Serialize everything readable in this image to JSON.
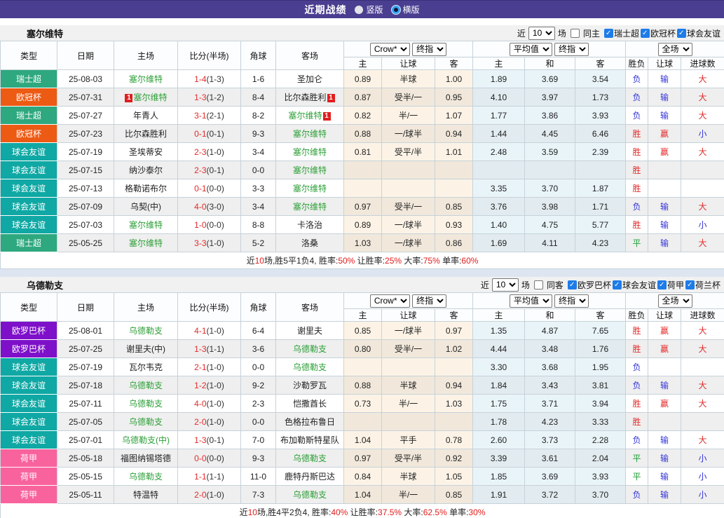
{
  "topbar": {
    "title": "近期战绩",
    "vertical": "竖版",
    "horizontal": "横版"
  },
  "colors": {
    "topbar_bg": "#4a3e91",
    "team_link_green": "#2fa039",
    "score_red": "#e32a2a",
    "checkbox_blue": "#1e7ce8",
    "section_gap": "#dde6f0"
  },
  "league_colors": {
    "瑞士超": "#2ea87e",
    "欧冠杯": "#ec5a14",
    "球会友谊": "#0fa8a4",
    "欧罗巴杯": "#7e10c9",
    "荷甲": "#f8639e"
  },
  "result_colors": {
    "胜": "#e32a2a",
    "赢": "#e32a2a",
    "大": "#e32a2a",
    "负": "#3434d8",
    "输": "#3434d8",
    "小": "#3434d8",
    "平": "#1ea038"
  },
  "table": {
    "cols": {
      "type": "类型",
      "date": "日期",
      "home": "主场",
      "score": "比分(半场)",
      "corner": "角球",
      "away": "客场",
      "h": "主",
      "handicap": "让球",
      "a": "客",
      "avg_h": "主",
      "avg_d": "和",
      "avg_a": "客",
      "result": "胜负",
      "result_handicap": "让球",
      "result_goals": "进球数"
    },
    "selects": {
      "source": "Crow*",
      "final": "终指",
      "average": "平均值",
      "final2": "终指",
      "scope": "全场"
    }
  },
  "sections": [
    {
      "team": "塞尔维特",
      "near": "近",
      "count": "10",
      "games": "场",
      "same": "同主",
      "leagues": [
        "瑞士超",
        "欧冠杯",
        "球会友谊"
      ],
      "rows": [
        {
          "league": "瑞士超",
          "date": "25-08-03",
          "home": {
            "name": "塞尔维特",
            "self": true
          },
          "score": "1-4",
          "half": "(1-3)",
          "corner": "1-6",
          "away": {
            "name": "圣加仑"
          },
          "odds": [
            "0.89",
            "半球",
            "1.00"
          ],
          "avg": [
            "1.89",
            "3.69",
            "3.54"
          ],
          "results": [
            "负",
            "输",
            "大"
          ]
        },
        {
          "league": "欧冠杯",
          "date": "25-07-31",
          "home": {
            "name": "塞尔维特",
            "self": true,
            "card_pre": "1"
          },
          "score": "1-3",
          "half": "(1-2)",
          "corner": "8-4",
          "away": {
            "name": "比尔森胜利",
            "card_post": "1"
          },
          "odds": [
            "0.87",
            "受半/一",
            "0.95"
          ],
          "avg": [
            "4.10",
            "3.97",
            "1.73"
          ],
          "results": [
            "负",
            "输",
            "大"
          ]
        },
        {
          "league": "瑞士超",
          "date": "25-07-27",
          "home": {
            "name": "年青人"
          },
          "score": "3-1",
          "half": "(2-1)",
          "corner": "8-2",
          "away": {
            "name": "塞尔维特",
            "self": true,
            "card_post": "1"
          },
          "odds": [
            "0.82",
            "半/一",
            "1.07"
          ],
          "avg": [
            "1.77",
            "3.86",
            "3.93"
          ],
          "results": [
            "负",
            "输",
            "大"
          ]
        },
        {
          "league": "欧冠杯",
          "date": "25-07-23",
          "home": {
            "name": "比尔森胜利"
          },
          "score": "0-1",
          "half": "(0-1)",
          "corner": "9-3",
          "away": {
            "name": "塞尔维特",
            "self": true
          },
          "odds": [
            "0.88",
            "一/球半",
            "0.94"
          ],
          "avg": [
            "1.44",
            "4.45",
            "6.46"
          ],
          "results": [
            "胜",
            "赢",
            "小"
          ]
        },
        {
          "league": "球会友谊",
          "date": "25-07-19",
          "home": {
            "name": "圣埃蒂安"
          },
          "score": "2-3",
          "half": "(1-0)",
          "corner": "3-4",
          "away": {
            "name": "塞尔维特",
            "self": true
          },
          "odds": [
            "0.81",
            "受平/半",
            "1.01"
          ],
          "avg": [
            "2.48",
            "3.59",
            "2.39"
          ],
          "results": [
            "胜",
            "赢",
            "大"
          ]
        },
        {
          "league": "球会友谊",
          "date": "25-07-15",
          "home": {
            "name": "纳沙泰尔"
          },
          "score": "2-3",
          "half": "(0-1)",
          "corner": "0-0",
          "away": {
            "name": "塞尔维特",
            "self": true
          },
          "odds": [
            "",
            "",
            ""
          ],
          "avg": [
            "",
            "",
            ""
          ],
          "results": [
            "胜",
            "",
            ""
          ]
        },
        {
          "league": "球会友谊",
          "date": "25-07-13",
          "home": {
            "name": "格勒诺布尔"
          },
          "score": "0-1",
          "half": "(0-0)",
          "corner": "3-3",
          "away": {
            "name": "塞尔维特",
            "self": true
          },
          "odds": [
            "",
            "",
            ""
          ],
          "avg": [
            "3.35",
            "3.70",
            "1.87"
          ],
          "results": [
            "胜",
            "",
            ""
          ]
        },
        {
          "league": "球会友谊",
          "date": "25-07-09",
          "home": {
            "name": "乌契(中)"
          },
          "score": "4-0",
          "half": "(3-0)",
          "corner": "3-4",
          "away": {
            "name": "塞尔维特",
            "self": true
          },
          "odds": [
            "0.97",
            "受半/一",
            "0.85"
          ],
          "avg": [
            "3.76",
            "3.98",
            "1.71"
          ],
          "results": [
            "负",
            "输",
            "大"
          ]
        },
        {
          "league": "球会友谊",
          "date": "25-07-03",
          "home": {
            "name": "塞尔维特",
            "self": true
          },
          "score": "1-0",
          "half": "(0-0)",
          "corner": "8-8",
          "away": {
            "name": "卡洛治"
          },
          "odds": [
            "0.89",
            "一/球半",
            "0.93"
          ],
          "avg": [
            "1.40",
            "4.75",
            "5.77"
          ],
          "results": [
            "胜",
            "输",
            "小"
          ]
        },
        {
          "league": "瑞士超",
          "date": "25-05-25",
          "home": {
            "name": "塞尔维特",
            "self": true
          },
          "score": "3-3",
          "half": "(1-0)",
          "corner": "5-2",
          "away": {
            "name": "洛桑"
          },
          "odds": [
            "1.03",
            "一/球半",
            "0.86"
          ],
          "avg": [
            "1.69",
            "4.11",
            "4.23"
          ],
          "results": [
            "平",
            "输",
            "大"
          ]
        }
      ],
      "summary": [
        [
          "近",
          "k"
        ],
        [
          "10",
          "r"
        ],
        [
          "场,胜5平1负4, 胜率:",
          "k"
        ],
        [
          "50%",
          "r"
        ],
        [
          " 让胜率:",
          "k"
        ],
        [
          "25%",
          "r"
        ],
        [
          " 大率:",
          "k"
        ],
        [
          "75%",
          "r"
        ],
        [
          " 单率:",
          "k"
        ],
        [
          "60%",
          "r"
        ]
      ]
    },
    {
      "team": "乌德勒支",
      "near": "近",
      "count": "10",
      "games": "场",
      "same": "同客",
      "leagues": [
        "欧罗巴杯",
        "球会友谊",
        "荷甲",
        "荷兰杯"
      ],
      "rows": [
        {
          "league": "欧罗巴杯",
          "date": "25-08-01",
          "home": {
            "name": "乌德勒支",
            "self": true
          },
          "score": "4-1",
          "half": "(1-0)",
          "corner": "6-4",
          "away": {
            "name": "谢里夫"
          },
          "odds": [
            "0.85",
            "一/球半",
            "0.97"
          ],
          "avg": [
            "1.35",
            "4.87",
            "7.65"
          ],
          "results": [
            "胜",
            "赢",
            "大"
          ]
        },
        {
          "league": "欧罗巴杯",
          "date": "25-07-25",
          "home": {
            "name": "谢里夫(中)"
          },
          "score": "1-3",
          "half": "(1-1)",
          "corner": "3-6",
          "away": {
            "name": "乌德勒支",
            "self": true
          },
          "odds": [
            "0.80",
            "受半/一",
            "1.02"
          ],
          "avg": [
            "4.44",
            "3.48",
            "1.76"
          ],
          "results": [
            "胜",
            "赢",
            "大"
          ]
        },
        {
          "league": "球会友谊",
          "date": "25-07-19",
          "home": {
            "name": "瓦尔韦克"
          },
          "score": "2-1",
          "half": "(1-0)",
          "corner": "0-0",
          "away": {
            "name": "乌德勒支",
            "self": true
          },
          "odds": [
            "",
            "",
            ""
          ],
          "avg": [
            "3.30",
            "3.68",
            "1.95"
          ],
          "results": [
            "负",
            "",
            ""
          ]
        },
        {
          "league": "球会友谊",
          "date": "25-07-18",
          "home": {
            "name": "乌德勒支",
            "self": true
          },
          "score": "1-2",
          "half": "(1-0)",
          "corner": "9-2",
          "away": {
            "name": "沙勒罗瓦"
          },
          "odds": [
            "0.88",
            "半球",
            "0.94"
          ],
          "avg": [
            "1.84",
            "3.43",
            "3.81"
          ],
          "results": [
            "负",
            "输",
            "大"
          ]
        },
        {
          "league": "球会友谊",
          "date": "25-07-11",
          "home": {
            "name": "乌德勒支",
            "self": true
          },
          "score": "4-0",
          "half": "(1-0)",
          "corner": "2-3",
          "away": {
            "name": "恺撒酋长"
          },
          "odds": [
            "0.73",
            "半/一",
            "1.03"
          ],
          "avg": [
            "1.75",
            "3.71",
            "3.94"
          ],
          "results": [
            "胜",
            "赢",
            "大"
          ]
        },
        {
          "league": "球会友谊",
          "date": "25-07-05",
          "home": {
            "name": "乌德勒支",
            "self": true
          },
          "score": "2-0",
          "half": "(1-0)",
          "corner": "0-0",
          "away": {
            "name": "色格拉布鲁日"
          },
          "odds": [
            "",
            "",
            ""
          ],
          "avg": [
            "1.78",
            "4.23",
            "3.33"
          ],
          "results": [
            "胜",
            "",
            ""
          ]
        },
        {
          "league": "球会友谊",
          "date": "25-07-01",
          "home": {
            "name": "乌德勒支(中)",
            "self": true
          },
          "score": "1-3",
          "half": "(0-1)",
          "corner": "7-0",
          "away": {
            "name": "布加勒斯特星队"
          },
          "odds": [
            "1.04",
            "平手",
            "0.78"
          ],
          "avg": [
            "2.60",
            "3.73",
            "2.28"
          ],
          "results": [
            "负",
            "输",
            "大"
          ]
        },
        {
          "league": "荷甲",
          "date": "25-05-18",
          "home": {
            "name": "福图纳锡塔德"
          },
          "score": "0-0",
          "half": "(0-0)",
          "corner": "9-3",
          "away": {
            "name": "乌德勒支",
            "self": true
          },
          "odds": [
            "0.97",
            "受平/半",
            "0.92"
          ],
          "avg": [
            "3.39",
            "3.61",
            "2.04"
          ],
          "results": [
            "平",
            "输",
            "小"
          ]
        },
        {
          "league": "荷甲",
          "date": "25-05-15",
          "home": {
            "name": "乌德勒支",
            "self": true
          },
          "score": "1-1",
          "half": "(1-1)",
          "corner": "11-0",
          "away": {
            "name": "鹿特丹斯巴达"
          },
          "odds": [
            "0.84",
            "半球",
            "1.05"
          ],
          "avg": [
            "1.85",
            "3.69",
            "3.93"
          ],
          "results": [
            "平",
            "输",
            "小"
          ]
        },
        {
          "league": "荷甲",
          "date": "25-05-11",
          "home": {
            "name": "特温特"
          },
          "score": "2-0",
          "half": "(1-0)",
          "corner": "7-3",
          "away": {
            "name": "乌德勒支",
            "self": true
          },
          "odds": [
            "1.04",
            "半/一",
            "0.85"
          ],
          "avg": [
            "1.91",
            "3.72",
            "3.70"
          ],
          "results": [
            "负",
            "输",
            "小"
          ]
        }
      ],
      "summary": [
        [
          "近",
          "k"
        ],
        [
          "10",
          "r"
        ],
        [
          "场,胜4平2负4, 胜率:",
          "k"
        ],
        [
          "40%",
          "r"
        ],
        [
          " 让胜率:",
          "k"
        ],
        [
          "37.5%",
          "r"
        ],
        [
          " 大率:",
          "k"
        ],
        [
          "62.5%",
          "r"
        ],
        [
          " 单率:",
          "k"
        ],
        [
          "30%",
          "r"
        ]
      ]
    }
  ]
}
